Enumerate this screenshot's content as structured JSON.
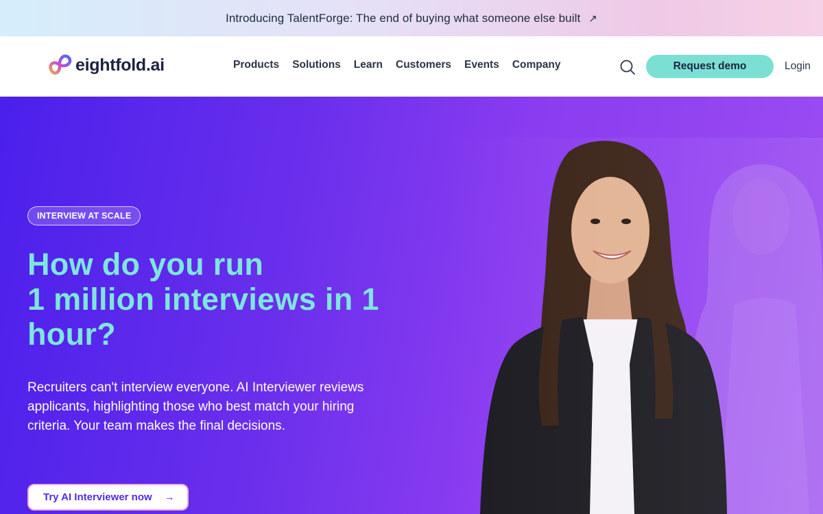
{
  "banner": {
    "text": "Introducing TalentForge: The end of buying what someone else built",
    "arrow": "↗"
  },
  "nav": {
    "logo_text": "eightfold.ai",
    "menu": [
      "Products",
      "Solutions",
      "Learn",
      "Customers",
      "Events",
      "Company"
    ],
    "search_icon": "search-icon",
    "demo_label": "Request demo",
    "login_label": "Login"
  },
  "hero": {
    "tag": "INTERVIEW AT SCALE",
    "headline": [
      "How do you run",
      "1 million interviews in 1",
      "hour?"
    ],
    "description": "Recruiters can't interview everyone. AI Interviewer reviews applicants, highlighting those who best match your hiring criteria. Your team makes the final decisions.",
    "cta_label": "Try AI Interviewer now",
    "cta_arrow": "→"
  },
  "colors": {
    "accent_teal": "#7be0d3",
    "headline_teal": "#7ee6dc",
    "hero_purple_start": "#4b20ec",
    "hero_purple_end": "#9d4ef2",
    "cta_text": "#4b2fe3"
  }
}
